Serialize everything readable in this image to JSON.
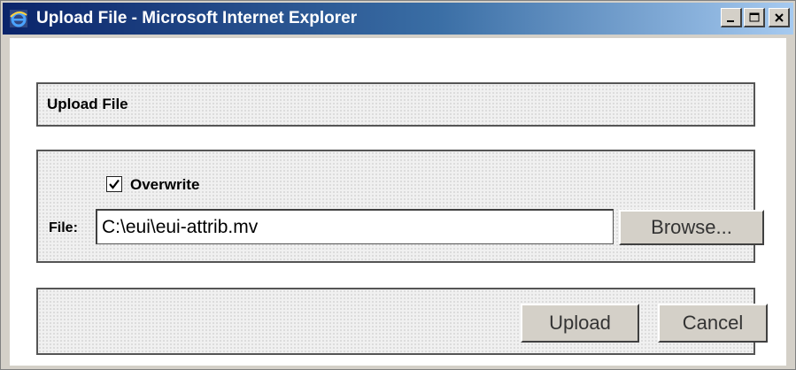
{
  "window": {
    "title": "Upload File - Microsoft Internet Explorer",
    "icon": "ie-icon",
    "controls": [
      "minimize-icon",
      "maximize-icon",
      "close-icon"
    ]
  },
  "header": {
    "title": "Upload File"
  },
  "form": {
    "overwrite": {
      "label": "Overwrite",
      "checked": true
    },
    "file": {
      "label": "File:",
      "value": "C:\\eui\\eui-attrib.mv",
      "browse_label": "Browse..."
    }
  },
  "actions": {
    "upload_label": "Upload",
    "cancel_label": "Cancel"
  },
  "colors": {
    "titlebar_start": "#0a246a",
    "titlebar_end": "#a6caf0",
    "button_face": "#d4d0c8"
  }
}
